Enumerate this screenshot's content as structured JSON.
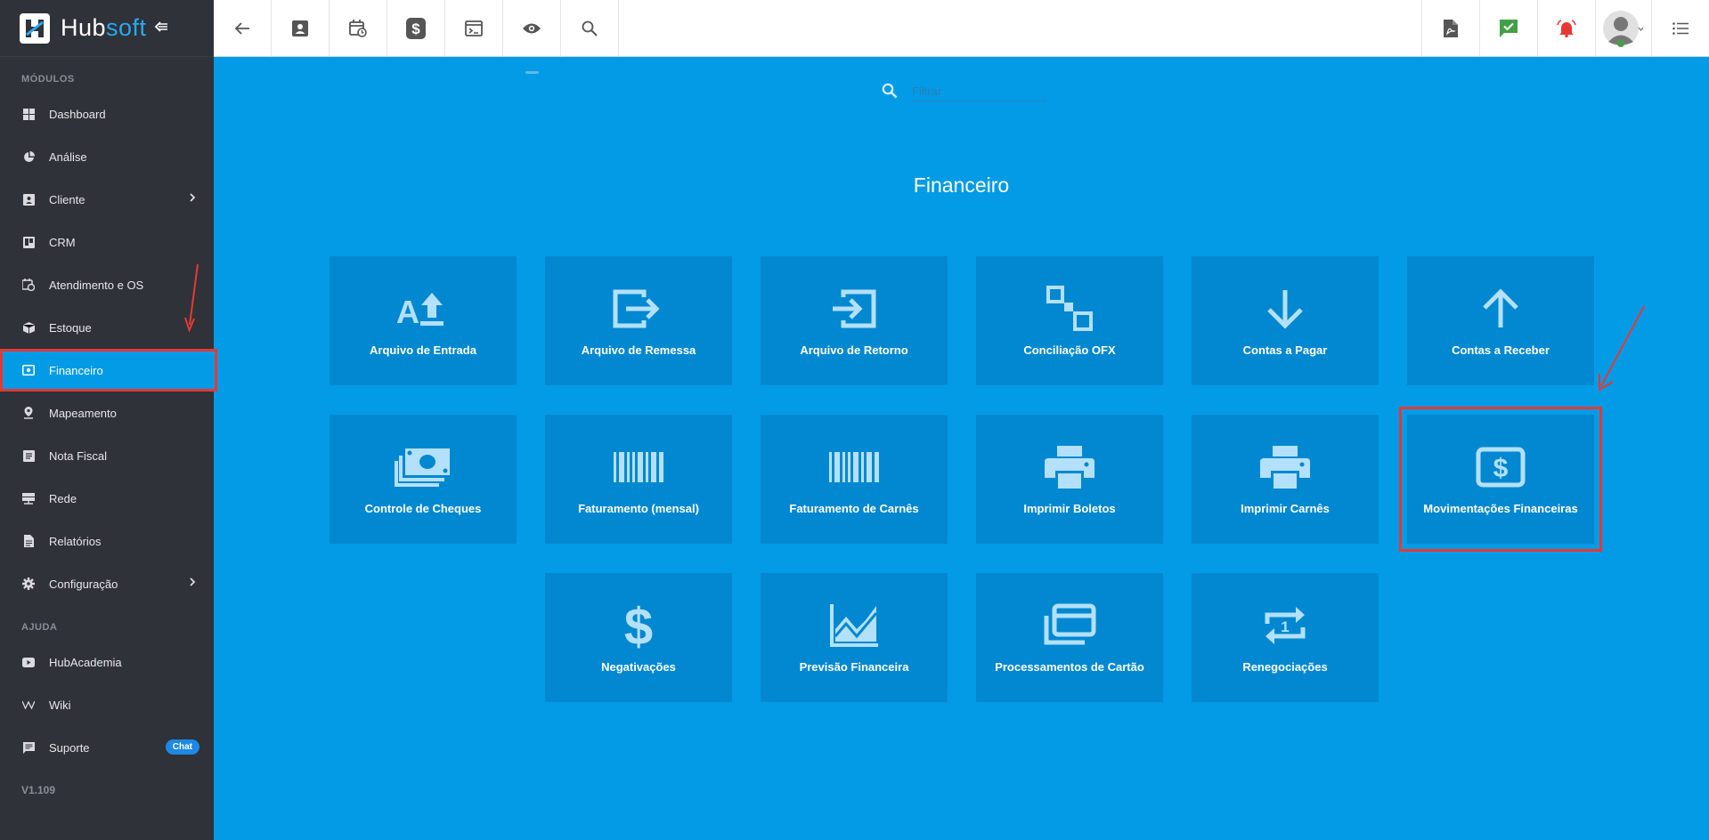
{
  "brand": {
    "name_part1": "Hub",
    "name_part2": "soft"
  },
  "sidebar": {
    "modules_title": "MÓDULOS",
    "items": [
      {
        "label": "Dashboard",
        "icon": "dashboard-icon"
      },
      {
        "label": "Análise",
        "icon": "pie-chart-icon"
      },
      {
        "label": "Cliente",
        "icon": "contact-card-icon"
      },
      {
        "label": "CRM",
        "icon": "board-icon"
      },
      {
        "label": "Atendimento e OS",
        "icon": "calendar-clock-icon"
      },
      {
        "label": "Estoque",
        "icon": "box-icon"
      },
      {
        "label": "Financeiro",
        "icon": "money-icon"
      },
      {
        "label": "Mapeamento",
        "icon": "map-pin-icon"
      },
      {
        "label": "Nota Fiscal",
        "icon": "receipt-icon"
      },
      {
        "label": "Rede",
        "icon": "server-icon"
      },
      {
        "label": "Relatórios",
        "icon": "report-icon"
      },
      {
        "label": "Configuração",
        "icon": "gear-icon"
      }
    ],
    "help_title": "AJUDA",
    "help_items": [
      {
        "label": "HubAcademia",
        "icon": "youtube-icon"
      },
      {
        "label": "Wiki",
        "icon": "wiki-icon"
      },
      {
        "label": "Suporte",
        "icon": "chat-icon",
        "badge": "Chat"
      }
    ],
    "version": "V1.109"
  },
  "search": {
    "placeholder": "Filtrar"
  },
  "page_title": "Financeiro",
  "tiles": [
    {
      "label": "Arquivo de Entrada",
      "icon": "text-upload-icon"
    },
    {
      "label": "Arquivo de Remessa",
      "icon": "exit-icon"
    },
    {
      "label": "Arquivo de Retorno",
      "icon": "enter-icon"
    },
    {
      "label": "Conciliação OFX",
      "icon": "squares-icon"
    },
    {
      "label": "Contas a Pagar",
      "icon": "arrow-down-icon"
    },
    {
      "label": "Contas a Receber",
      "icon": "arrow-up-icon"
    },
    {
      "label": "Controle de Cheques",
      "icon": "cash-stack-icon"
    },
    {
      "label": "Faturamento (mensal)",
      "icon": "barcode-icon"
    },
    {
      "label": "Faturamento de Carnês",
      "icon": "barcode-icon"
    },
    {
      "label": "Imprimir Boletos",
      "icon": "printer-icon"
    },
    {
      "label": "Imprimir Carnês",
      "icon": "printer-icon"
    },
    {
      "label": "Movimentações Financeiras",
      "icon": "dollar-box-icon"
    },
    {
      "label": "Negativações",
      "icon": "dollar-icon"
    },
    {
      "label": "Previsão Financeira",
      "icon": "area-chart-icon"
    },
    {
      "label": "Processamentos de Cartão",
      "icon": "cards-icon"
    },
    {
      "label": "Renegociações",
      "icon": "repeat-one-icon"
    }
  ],
  "colors": {
    "accent": "#039be5",
    "tile": "#0288d1",
    "sidebar": "#2f3238",
    "annotation": "#e53935"
  }
}
